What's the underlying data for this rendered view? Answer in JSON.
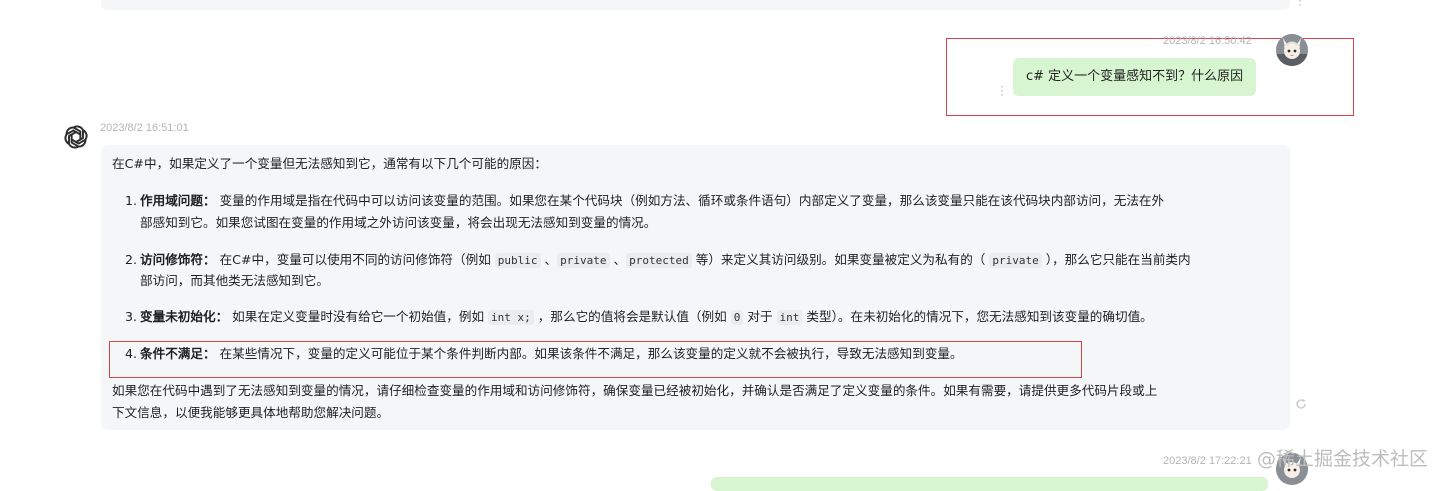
{
  "conversation": {
    "user_message": {
      "timestamp": "2023/8/2 16:50:42",
      "text": "c# 定义一个变量感知不到？什么原因"
    },
    "assistant_message": {
      "timestamp": "2023/8/2 16:51:01",
      "intro": "在C#中，如果定义了一个变量但无法感知到它，通常有以下几个可能的原因：",
      "items": [
        {
          "num": "1.",
          "title": "作用域问题：",
          "line1": " 变量的作用域是指在代码中可以访问该变量的范围。如果您在某个代码块（例如方法、循环或条件语句）内部定义了变量，那么该变量只能在该代码块内部访问，无法在外",
          "line2": "部感知到它。如果您试图在变量的作用域之外访问该变量，将会出现无法感知到变量的情况。"
        },
        {
          "num": "2.",
          "title": "访问修饰符：",
          "seg1": " 在C#中，变量可以使用不同的访问修饰符（例如 ",
          "code1": "public",
          "sep1": " 、",
          "code2": "private",
          "sep2": " 、",
          "code3": "protected",
          "seg2": " 等）来定义其访问级别。如果变量被定义为私有的（ ",
          "code4": "private",
          "seg3": " ），那么它只能在当前类内",
          "line2": "部访问，而其他类无法感知到它。"
        },
        {
          "num": "3.",
          "title": "变量未初始化：",
          "seg1": " 如果在定义变量时没有给它一个初始值，例如 ",
          "code1": "int x;",
          "seg2": " ，那么它的值将会是默认值（例如 ",
          "code2": "0",
          "seg3": " 对于 ",
          "code3": "int",
          "seg4": " 类型）。在未初始化的情况下，您无法感知到该变量的确切值。"
        },
        {
          "num": "4.",
          "title": "条件不满足：",
          "line1": " 在某些情况下，变量的定义可能位于某个条件判断内部。如果该条件不满足，那么该变量的定义就不会被执行，导致无法感知到变量。"
        }
      ],
      "outro_line1": "如果您在代码中遇到了无法感知到变量的情况，请仔细检查变量的作用域和访问修饰符，确保变量已经被初始化，并确认是否满足了定义变量的条件。如果有需要，请提供更多代码片段或上",
      "outro_line2": "下文信息，以便我能够更具体地帮助您解决问题。"
    },
    "next_user_timestamp": "2023/8/2 17:22:21"
  },
  "watermark": "@稀土掘金技术社区",
  "colors": {
    "user_bubble": "#d7f5d0",
    "assistant_bubble": "#f4f6f8",
    "highlight_border": "#d9444a",
    "timestamp": "#b4b4b4"
  },
  "icons": {
    "assistant_avatar": "openai-logo-icon",
    "user_avatar": "anime-character-avatar",
    "more": "vertical-dots-icon",
    "refresh": "refresh-icon"
  }
}
